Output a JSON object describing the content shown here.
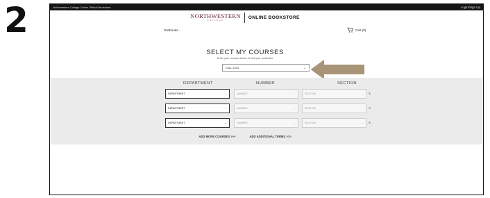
{
  "step_number": "2",
  "topbar": {
    "title": "Northwestern College Online Official Bookstore",
    "login": "Login/Sign Up"
  },
  "brand": {
    "logo_text": "NORTHWESTERN",
    "logo_subtext": "COLLEGE",
    "store_name": "ONLINE BOOKSTORE"
  },
  "nav": {
    "textbooks": "Textbooks",
    "cart": "Cart (0)"
  },
  "select_courses": {
    "heading": "SELECT MY COURSES",
    "subheading": "Enter your courses below to find your textbooks",
    "term_value": "FALL 2020"
  },
  "columns": {
    "department": "DEPARTMENT",
    "number": "NUMBER",
    "section": "SECTION"
  },
  "rows": [
    {
      "department": "DEPARTMENT",
      "number": "NUMBER",
      "section": "SECTION",
      "remove": "X"
    },
    {
      "department": "DEPARTMENT",
      "number": "NUMBER",
      "section": "SECTION",
      "remove": "X"
    },
    {
      "department": "DEPARTMENT",
      "number": "NUMBER",
      "section": "SECTION",
      "remove": "X"
    }
  ],
  "actions": {
    "add_courses": "ADD MORE COURSES >>>",
    "add_terms": "ADD ADDITIONAL TERMS >>>"
  },
  "colors": {
    "brand": "#5b1a2a",
    "arrow": "#a89476",
    "panel": "#ebebeb",
    "topbar": "#151515"
  }
}
